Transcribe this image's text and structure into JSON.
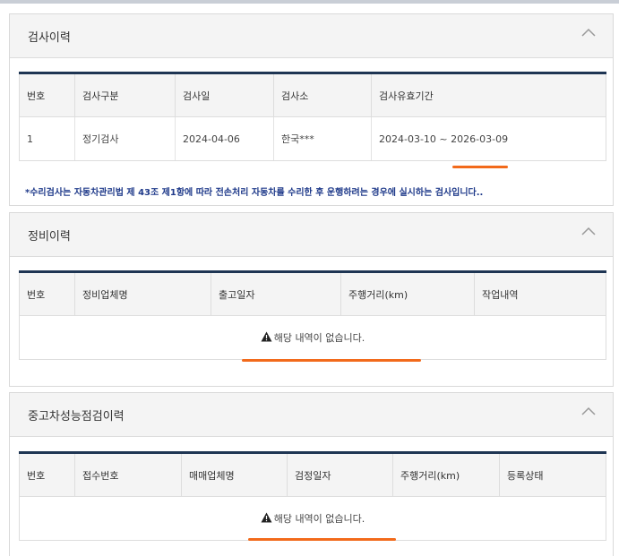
{
  "inspection": {
    "title": "검사이력",
    "columns": [
      "번호",
      "검사구분",
      "검사일",
      "검사소",
      "검사유효기간"
    ],
    "rows": [
      {
        "no": "1",
        "type": "정기검사",
        "date": "2024-04-06",
        "station": "한국***",
        "validity": "2024-03-10 ~ 2026-03-09"
      }
    ],
    "note": "*수리검사는 자동차관리법 제 43조 제1항에 따라 전손처리 자동차를 수리한 후 운행하려는 경우에 실시하는 검사입니다.."
  },
  "maintenance": {
    "title": "정비이력",
    "columns": [
      "번호",
      "정비업체명",
      "출고일자",
      "주행거리(km)",
      "작업내역"
    ],
    "empty_message": "해당 내역이 없습니다."
  },
  "performance": {
    "title": "중고차성능점검이력",
    "columns": [
      "번호",
      "접수번호",
      "매매업체명",
      "검정일자",
      "주행거리(km)",
      "등록상태"
    ],
    "empty_message": "해당 내역이 없습니다."
  },
  "colors": {
    "table_top_border": "#1e3553",
    "note_text": "#1f3a8a",
    "highlight": "#f26a1b"
  },
  "icons": {
    "collapse": "chevron-up-icon",
    "warning": "warning-icon"
  }
}
